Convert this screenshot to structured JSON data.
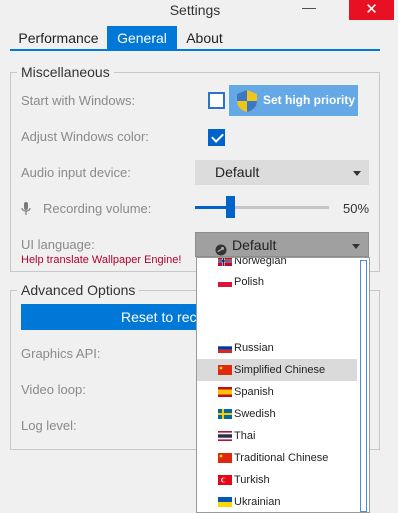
{
  "window": {
    "title": "Settings",
    "minimize": "—",
    "close": "✕"
  },
  "tabs": [
    {
      "label": "Performance"
    },
    {
      "label": "General"
    },
    {
      "label": "About"
    }
  ],
  "misc": {
    "title": "Miscellaneous",
    "start_with_windows": {
      "label": "Start with Windows:",
      "checked": false
    },
    "set_high_priority": "Set high priority",
    "adjust_color": {
      "label": "Adjust Windows color:",
      "checked": true
    },
    "audio_input": {
      "label": "Audio input device:",
      "value": "Default"
    },
    "recording_volume": {
      "label": "Recording volume:",
      "value_text": "50%",
      "level": 0.25
    },
    "ui_language": {
      "label": "UI language:",
      "value": "Default"
    },
    "help_translate": "Help translate Wallpaper Engine!"
  },
  "advanced": {
    "title": "Advanced Options",
    "reset_label": "Reset to rec",
    "graphics_api": "Graphics API:",
    "video_loop": "Video loop:",
    "log_level": "Log level:"
  },
  "language_options": [
    {
      "label": "Norwegian",
      "flag": "norway"
    },
    {
      "label": "Polish",
      "flag": "poland"
    },
    {
      "label": "Russian",
      "flag": "russia"
    },
    {
      "label": "Simplified Chinese",
      "flag": "china",
      "selected": true
    },
    {
      "label": "Spanish",
      "flag": "spain"
    },
    {
      "label": "Swedish",
      "flag": "sweden"
    },
    {
      "label": "Thai",
      "flag": "thailand"
    },
    {
      "label": "Traditional Chinese",
      "flag": "china"
    },
    {
      "label": "Turkish",
      "flag": "turkey"
    },
    {
      "label": "Ukrainian",
      "flag": "ukraine"
    }
  ],
  "colors": {
    "accent": "#0078d7",
    "close": "#e81123",
    "help_link": "#b3002d"
  }
}
